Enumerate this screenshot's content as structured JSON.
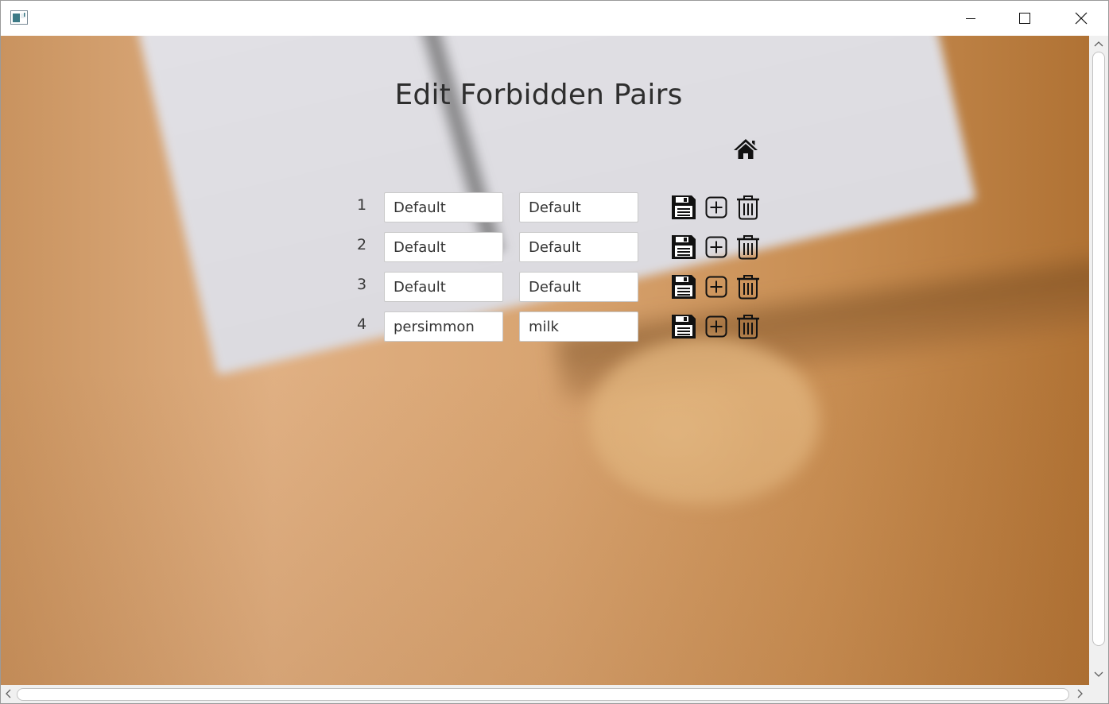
{
  "window": {
    "icons": {
      "app": "app-icon",
      "minimize": "minimize-icon",
      "maximize": "maximize-icon",
      "close": "close-icon"
    }
  },
  "page": {
    "title": "Edit Forbidden Pairs",
    "home_icon": "home-icon"
  },
  "pairs": [
    {
      "index": "1",
      "first": "Default",
      "second": "Default"
    },
    {
      "index": "2",
      "first": "Default",
      "second": "Default"
    },
    {
      "index": "3",
      "first": "Default",
      "second": "Default"
    },
    {
      "index": "4",
      "first": "persimmon",
      "second": "milk"
    }
  ],
  "row_actions": {
    "save": "save-icon",
    "add": "add-icon",
    "delete": "trash-icon"
  }
}
